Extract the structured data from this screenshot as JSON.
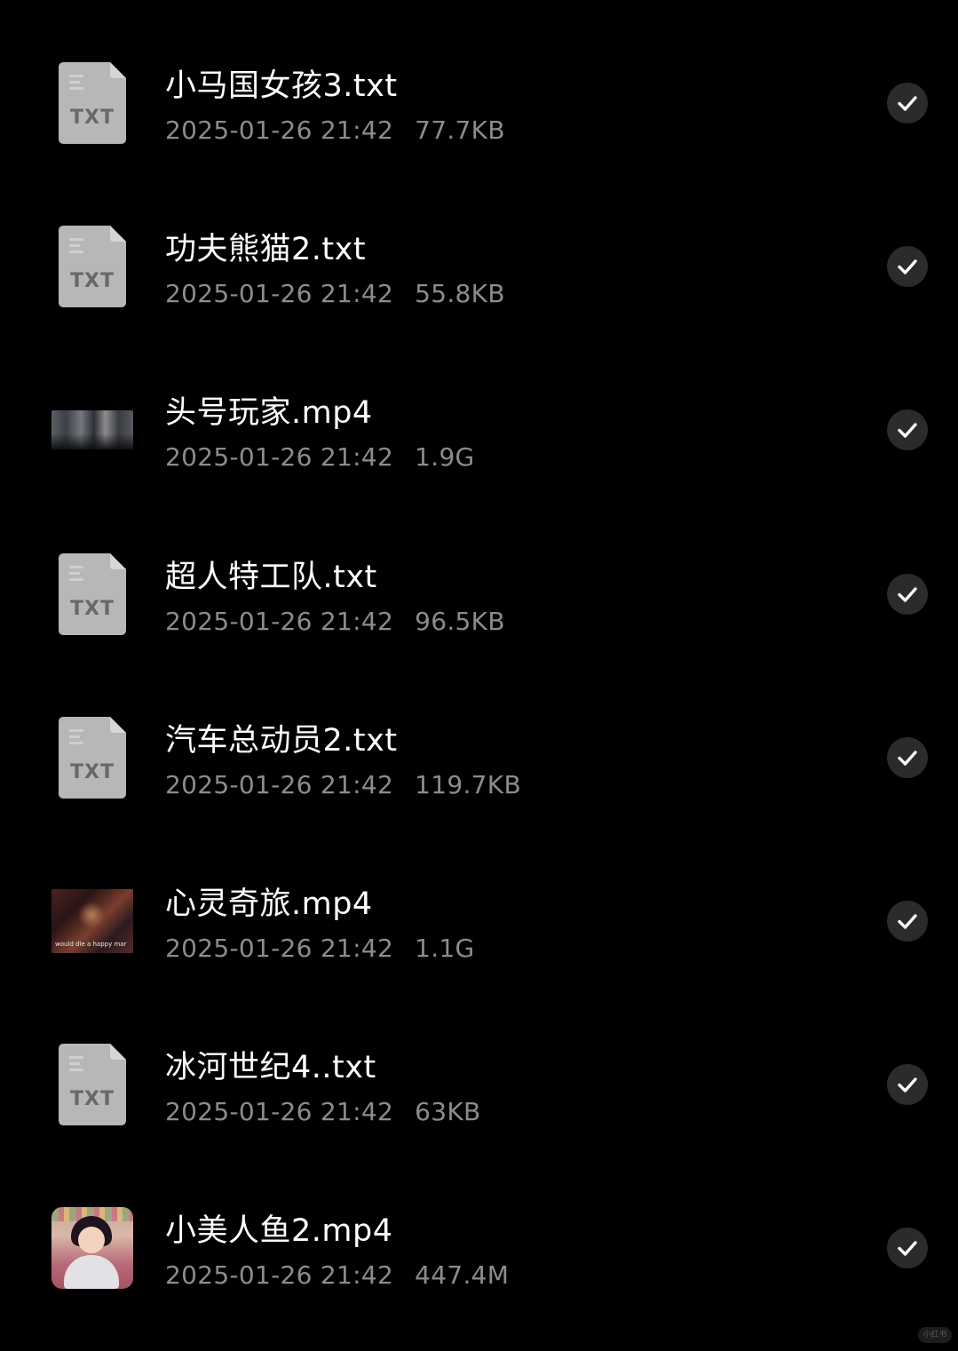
{
  "files": [
    {
      "name": "小马国女孩3.txt",
      "date": "2025-01-26 21:42",
      "size": "77.7KB",
      "type": "txt",
      "icon": "txt-file-icon",
      "icon_label": "TXT",
      "selected": true
    },
    {
      "name": "功夫熊猫2.txt",
      "date": "2025-01-26 21:42",
      "size": "55.8KB",
      "type": "txt",
      "icon": "txt-file-icon",
      "icon_label": "TXT",
      "selected": true
    },
    {
      "name": "头号玩家.mp4",
      "date": "2025-01-26 21:42",
      "size": "1.9G",
      "type": "mp4",
      "icon": "video-thumbnail",
      "thumb": "ready",
      "selected": true
    },
    {
      "name": "超人特工队.txt",
      "date": "2025-01-26 21:42",
      "size": "96.5KB",
      "type": "txt",
      "icon": "txt-file-icon",
      "icon_label": "TXT",
      "selected": true
    },
    {
      "name": "汽车总动员2.txt",
      "date": "2025-01-26 21:42",
      "size": "119.7KB",
      "type": "txt",
      "icon": "txt-file-icon",
      "icon_label": "TXT",
      "selected": true
    },
    {
      "name": "心灵奇旅.mp4",
      "date": "2025-01-26 21:42",
      "size": "1.1G",
      "type": "mp4",
      "icon": "video-thumbnail",
      "thumb": "soul",
      "thumb_caption": "would die a happy mar",
      "selected": true
    },
    {
      "name": "冰河世纪4..txt",
      "date": "2025-01-26 21:42",
      "size": "63KB",
      "type": "txt",
      "icon": "txt-file-icon",
      "icon_label": "TXT",
      "selected": true
    },
    {
      "name": "小美人鱼2.mp4",
      "date": "2025-01-26 21:42",
      "size": "447.4M",
      "type": "mp4",
      "icon": "video-thumbnail",
      "thumb": "mermaid",
      "selected": true
    }
  ],
  "colors": {
    "background": "#000000",
    "title_text": "#ffffff",
    "meta_text": "#8c8c8c",
    "check_bg": "#2b2b2b",
    "check_mark": "#ffffff",
    "txt_icon_fill": "#b7b7b7"
  },
  "watermark": "小红书"
}
